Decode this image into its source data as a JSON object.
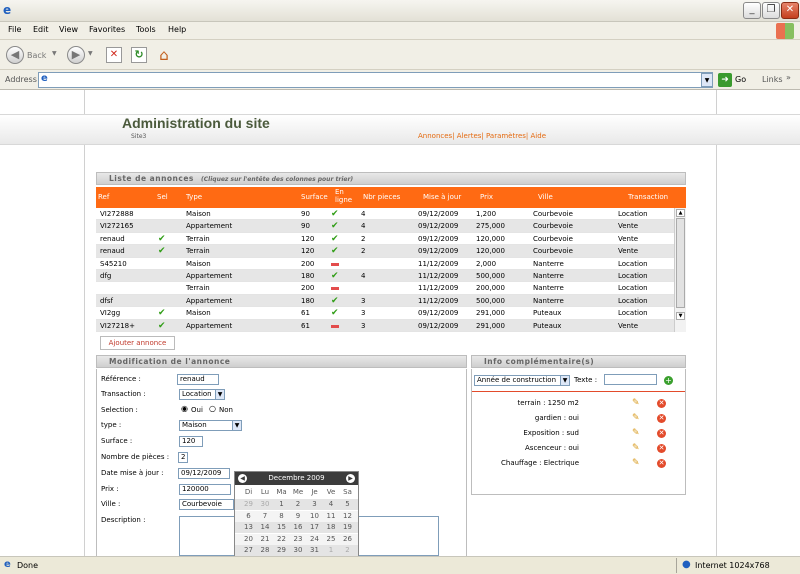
{
  "browser": {
    "menu": [
      "File",
      "Edit",
      "View",
      "Favorites",
      "Tools",
      "Help"
    ],
    "back_label": "Back",
    "address_label": "Address",
    "go_label": "Go",
    "links_label": "Links",
    "status_left": "Done",
    "status_right": "Internet 1024x768"
  },
  "header": {
    "title": "Administration du site",
    "site_label": "Site3",
    "nav": [
      "Annonces",
      "Alertes",
      "Paramètres",
      "Aide"
    ],
    "sep": "|"
  },
  "list": {
    "title": "Liste de annonces",
    "hint": "(Cliquez sur l'entête des colonnes pour trier)",
    "columns": {
      "ref": "Ref",
      "sel": "Sel",
      "type": "Type",
      "surface": "Surface",
      "online1": "En",
      "online2": "ligne",
      "rooms": "Nbr pieces",
      "updated": "Mise à jour",
      "price": "Prix",
      "city": "Ville",
      "transaction": "Transaction"
    },
    "rows": [
      {
        "ref": "VI272888",
        "sel": false,
        "type": "Maison",
        "surface": "90",
        "online": true,
        "rooms": "4",
        "date": "09/12/2009",
        "price": "1,200",
        "city": "Courbevoie",
        "transaction": "Location"
      },
      {
        "ref": "VI272165",
        "sel": false,
        "type": "Appartement",
        "surface": "90",
        "online": true,
        "rooms": "4",
        "date": "09/12/2009",
        "price": "275,000",
        "city": "Courbevoie",
        "transaction": "Vente"
      },
      {
        "ref": "renaud",
        "sel": true,
        "type": "Terrain",
        "surface": "120",
        "online": true,
        "rooms": "2",
        "date": "09/12/2009",
        "price": "120,000",
        "city": "Courbevoie",
        "transaction": "Vente"
      },
      {
        "ref": "renaud",
        "sel": true,
        "type": "Terrain",
        "surface": "120",
        "online": true,
        "rooms": "2",
        "date": "09/12/2009",
        "price": "120,000",
        "city": "Courbevoie",
        "transaction": "Vente"
      },
      {
        "ref": "S45210",
        "sel": false,
        "type": "Maison",
        "surface": "200",
        "online": false,
        "rooms": "",
        "date": "11/12/2009",
        "price": "2,000",
        "city": "Nanterre",
        "transaction": "Location"
      },
      {
        "ref": "dfg",
        "sel": false,
        "type": "Appartement",
        "surface": "180",
        "online": true,
        "rooms": "4",
        "date": "11/12/2009",
        "price": "500,000",
        "city": "Nanterre",
        "transaction": "Location"
      },
      {
        "ref": "",
        "sel": false,
        "type": "Terrain",
        "surface": "200",
        "online": false,
        "rooms": "",
        "date": "11/12/2009",
        "price": "200,000",
        "city": "Nanterre",
        "transaction": "Location"
      },
      {
        "ref": "dfsf",
        "sel": false,
        "type": "Appartement",
        "surface": "180",
        "online": true,
        "rooms": "3",
        "date": "11/12/2009",
        "price": "500,000",
        "city": "Nanterre",
        "transaction": "Location"
      },
      {
        "ref": "VI2gg",
        "sel": true,
        "type": "Maison",
        "surface": "61",
        "online": true,
        "rooms": "3",
        "date": "09/12/2009",
        "price": "291,000",
        "city": "Puteaux",
        "transaction": "Location"
      },
      {
        "ref": "VI27218+",
        "sel": true,
        "type": "Appartement",
        "surface": "61",
        "online": false,
        "rooms": "3",
        "date": "09/12/2009",
        "price": "291,000",
        "city": "Puteaux",
        "transaction": "Vente"
      }
    ],
    "add_button": "Ajouter annonce"
  },
  "edit": {
    "title": "Modification de l'annonce",
    "labels": {
      "ref": "Référence :",
      "transaction": "Transaction :",
      "selection": "Selection :",
      "type": "type :",
      "surface": "Surface :",
      "rooms": "Nombre de pièces :",
      "date": "Date mise à jour :",
      "price": "Prix :",
      "city": "Ville :",
      "desc": "Description :"
    },
    "values": {
      "ref": "renaud",
      "transaction": "Location",
      "type": "Maison",
      "surface": "120",
      "rooms": "2",
      "date": "09/12/2009",
      "price": "120000",
      "city": "Courbevoie"
    },
    "radio_yes": "Oui",
    "radio_no": "Non"
  },
  "calendar": {
    "month": "Decembre 2009",
    "prev": "◀",
    "next": "▶",
    "days": [
      "Di",
      "Lu",
      "Ma",
      "Me",
      "Je",
      "Ve",
      "Sa"
    ],
    "weeks": [
      [
        "29",
        "30",
        "1",
        "2",
        "3",
        "4",
        "5"
      ],
      [
        "6",
        "7",
        "8",
        "9",
        "10",
        "11",
        "12"
      ],
      [
        "13",
        "14",
        "15",
        "16",
        "17",
        "18",
        "19"
      ],
      [
        "20",
        "21",
        "22",
        "23",
        "24",
        "25",
        "26"
      ],
      [
        "27",
        "28",
        "29",
        "30",
        "31",
        "1",
        "2"
      ]
    ]
  },
  "info": {
    "title": "Info complémentaire(s)",
    "select": "Année de construction",
    "text_label": "Texte :",
    "items": [
      "terrain : 1250 m2",
      "gardien : oui",
      "Exposition : sud",
      "Ascenceur : oui",
      "Chauffage : Electrique"
    ]
  }
}
